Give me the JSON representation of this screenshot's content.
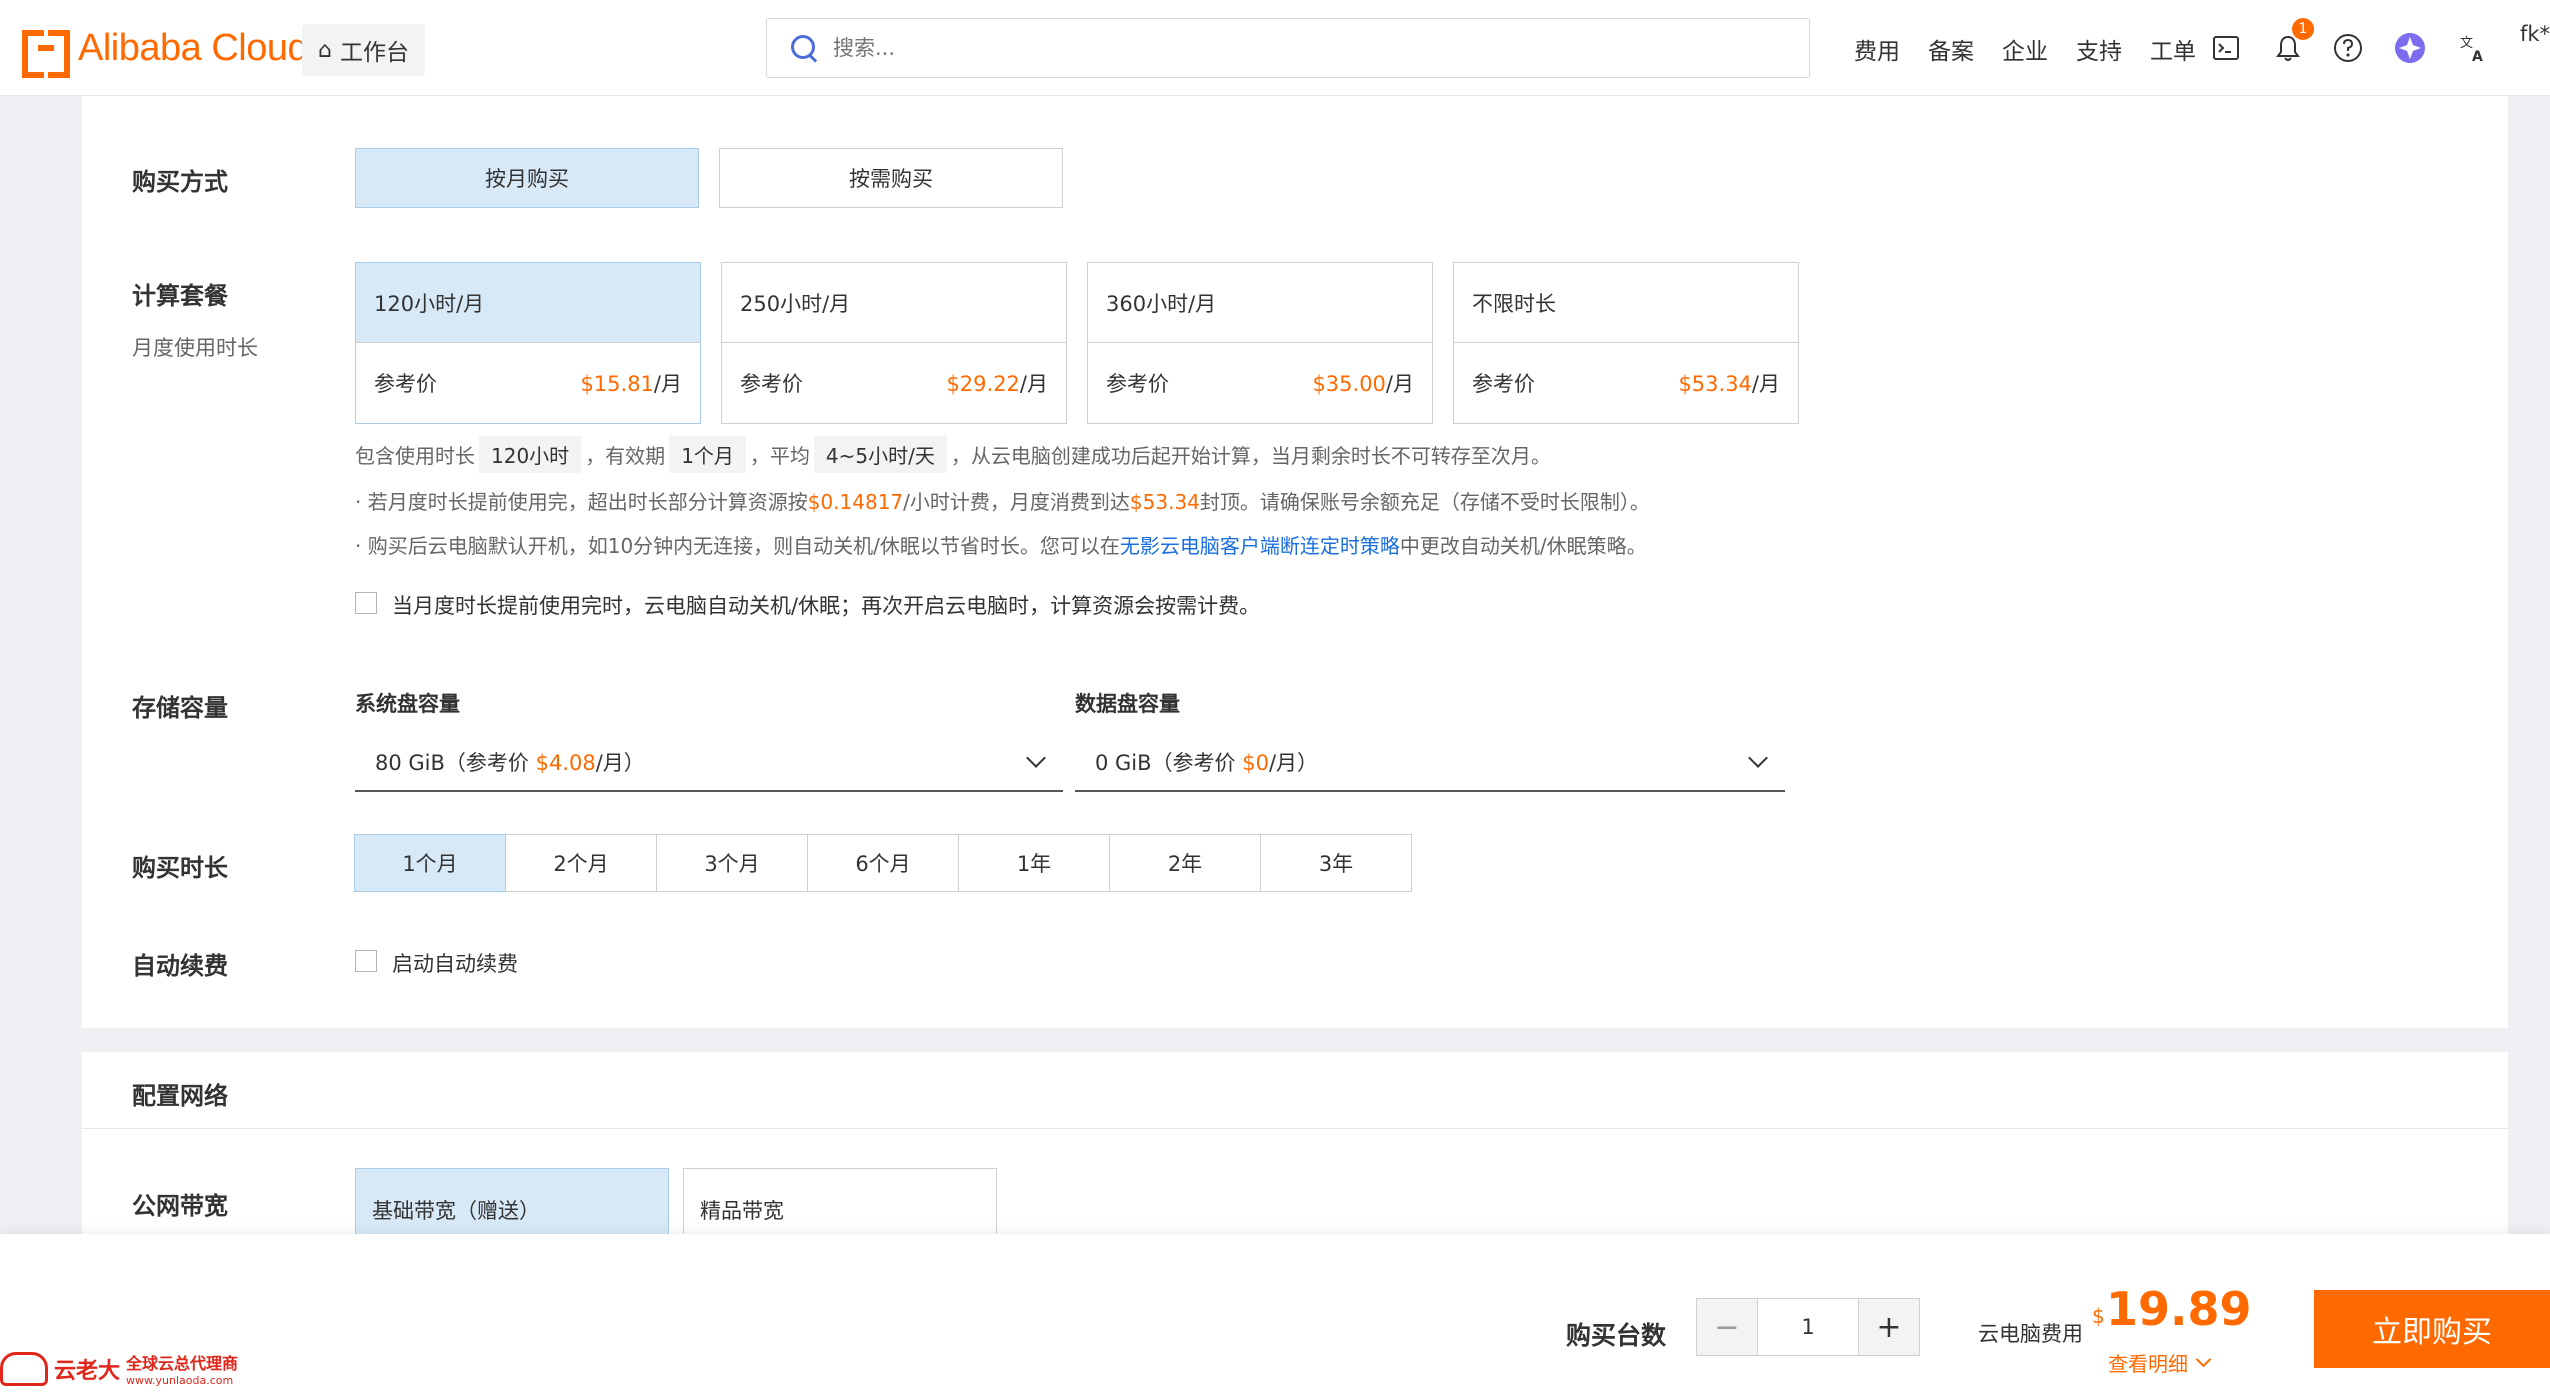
{
  "header": {
    "logo_text": "Alibaba Cloud",
    "workbench_label": "工作台",
    "search_placeholder": "搜索...",
    "nav_links": [
      "费用",
      "备案",
      "企业",
      "支持",
      "工单"
    ],
    "notification_count": "1",
    "user_initials": "fk*"
  },
  "purchase_method": {
    "label": "购买方式",
    "options": [
      {
        "label": "按月购买",
        "selected": true
      },
      {
        "label": "按需购买",
        "selected": false
      }
    ]
  },
  "compute_plan": {
    "label": "计算套餐",
    "sublabel": "月度使用时长",
    "ref_label": "参考价",
    "plans": [
      {
        "name": "120小时/月",
        "price": "$15.81",
        "unit": "/月",
        "selected": true
      },
      {
        "name": "250小时/月",
        "price": "$29.22",
        "unit": "/月",
        "selected": false
      },
      {
        "name": "360小时/月",
        "price": "$35.00",
        "unit": "/月",
        "selected": false
      },
      {
        "name": "不限时长",
        "price": "$53.34",
        "unit": "/月",
        "selected": false
      }
    ],
    "info1": {
      "p1": "包含使用时长",
      "chip1": "120小时",
      "p2": "，有效期",
      "chip2": "1个月",
      "p3": "，平均",
      "chip3": "4~5小时/天",
      "p4": "，从云电脑创建成功后起开始计算，当月剩余时长不可转存至次月。"
    },
    "info2": {
      "p1": "· 若月度时长提前使用完，超出时长部分计算资源按",
      "price1": "$0.14817",
      "p2": "/小时计费，月度消费到达",
      "price2": "$53.34",
      "p3": "封顶。请确保账号余额充足（存储不受时长限制）。"
    },
    "info3": {
      "p1": "· 购买后云电脑默认开机，如10分钟内无连接，则自动关机/休眠以节省时长。您可以在",
      "link": "无影云电脑客户端断连定时策略",
      "p2": "中更改自动关机/休眠策略。"
    },
    "auto_shutdown_checkbox": "当月度时长提前使用完时，云电脑自动关机/休眠；再次开启云电脑时，计算资源会按需计费。"
  },
  "storage": {
    "label": "存储容量",
    "system_disk": {
      "label": "系统盘容量",
      "value_pre": "80 GiB（参考价 ",
      "price": "$4.08",
      "value_post": "/月）"
    },
    "data_disk": {
      "label": "数据盘容量",
      "value_pre": "0 GiB（参考价 ",
      "price": "$0",
      "value_post": "/月）"
    }
  },
  "duration": {
    "label": "购买时长",
    "options": [
      "1个月",
      "2个月",
      "3个月",
      "6个月",
      "1年",
      "2年",
      "3年"
    ],
    "selected": "1个月"
  },
  "auto_renew": {
    "label": "自动续费",
    "checkbox": "启动自动续费"
  },
  "network": {
    "section_title": "配置网络",
    "bandwidth_label": "公网带宽",
    "options": [
      {
        "label": "基础带宽（赠送）",
        "selected": true
      },
      {
        "label": "精品带宽",
        "selected": false
      }
    ]
  },
  "footer": {
    "qty_label": "购买台数",
    "qty_value": "1",
    "fee_label": "云电脑费用",
    "currency": "$",
    "fee_value": "19.89",
    "detail_link": "查看明细",
    "buy_button": "立即购买"
  },
  "watermark": {
    "brand": "云老大",
    "line1": "全球云总代理商",
    "line2": "www.yunlaoda.com"
  },
  "colors": {
    "accent": "#ff6a00",
    "selected_bg": "#d7e9f7",
    "link": "#1a6fe0"
  }
}
